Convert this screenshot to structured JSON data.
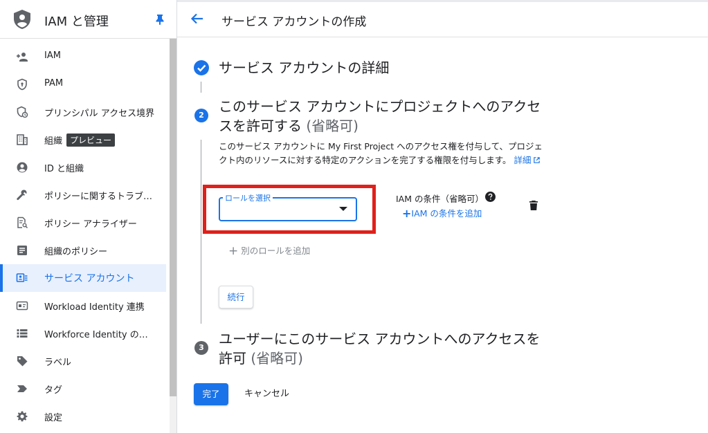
{
  "sidebar": {
    "title": "IAM と管理",
    "items": [
      {
        "label": "IAM",
        "icon": "person-add-icon"
      },
      {
        "label": "PAM",
        "icon": "shield-icon"
      },
      {
        "label": "プリンシパル アクセス境界",
        "icon": "policy-boundary-icon"
      },
      {
        "label": "組織",
        "icon": "building-icon",
        "badge": "プレビュー"
      },
      {
        "label": "ID と組織",
        "icon": "account-circle-icon"
      },
      {
        "label": "ポリシーに関するトラブルシューティング",
        "icon": "wrench-icon"
      },
      {
        "label": "ポリシー アナライザー",
        "icon": "document-search-icon"
      },
      {
        "label": "組織のポリシー",
        "icon": "list-document-icon"
      },
      {
        "label": "サービス アカウント",
        "icon": "service-account-icon",
        "active": true
      },
      {
        "label": "Workload Identity 連携",
        "icon": "id-card-icon"
      },
      {
        "label": "Workforce Identity の連携",
        "icon": "list-icon"
      },
      {
        "label": "ラベル",
        "icon": "label-icon"
      },
      {
        "label": "タグ",
        "icon": "tag-icon"
      },
      {
        "label": "設定",
        "icon": "gear-icon"
      }
    ]
  },
  "header": {
    "title": "サービス アカウントの作成"
  },
  "steps": {
    "step1": {
      "title": "サービス アカウントの詳細"
    },
    "step2": {
      "number": "2",
      "title": "このサービス アカウントにプロジェクトへのアクセスを許可する",
      "optional": "(省略可)",
      "description": "このサービス アカウントに My First Project へのアクセス権を付与して、プロジェクト内のリソースに対する特定のアクションを完了する権限を付与します。",
      "details_link": "詳細",
      "role_select_label": "ロールを選択",
      "iam_condition_label": "IAM の条件（省略可）",
      "add_condition_label": "IAM の条件を追加",
      "add_role_label": "別のロールを追加",
      "continue_label": "続行"
    },
    "step3": {
      "number": "3",
      "title": "ユーザーにこのサービス アカウントへのアクセスを許可",
      "optional": "(省略可)"
    }
  },
  "footer": {
    "done_label": "完了",
    "cancel_label": "キャンセル"
  },
  "colors": {
    "accent": "#1a73e8",
    "highlight": "#e0201b",
    "step2_badge": "#1a73e8",
    "step3_badge": "#5f6368"
  }
}
